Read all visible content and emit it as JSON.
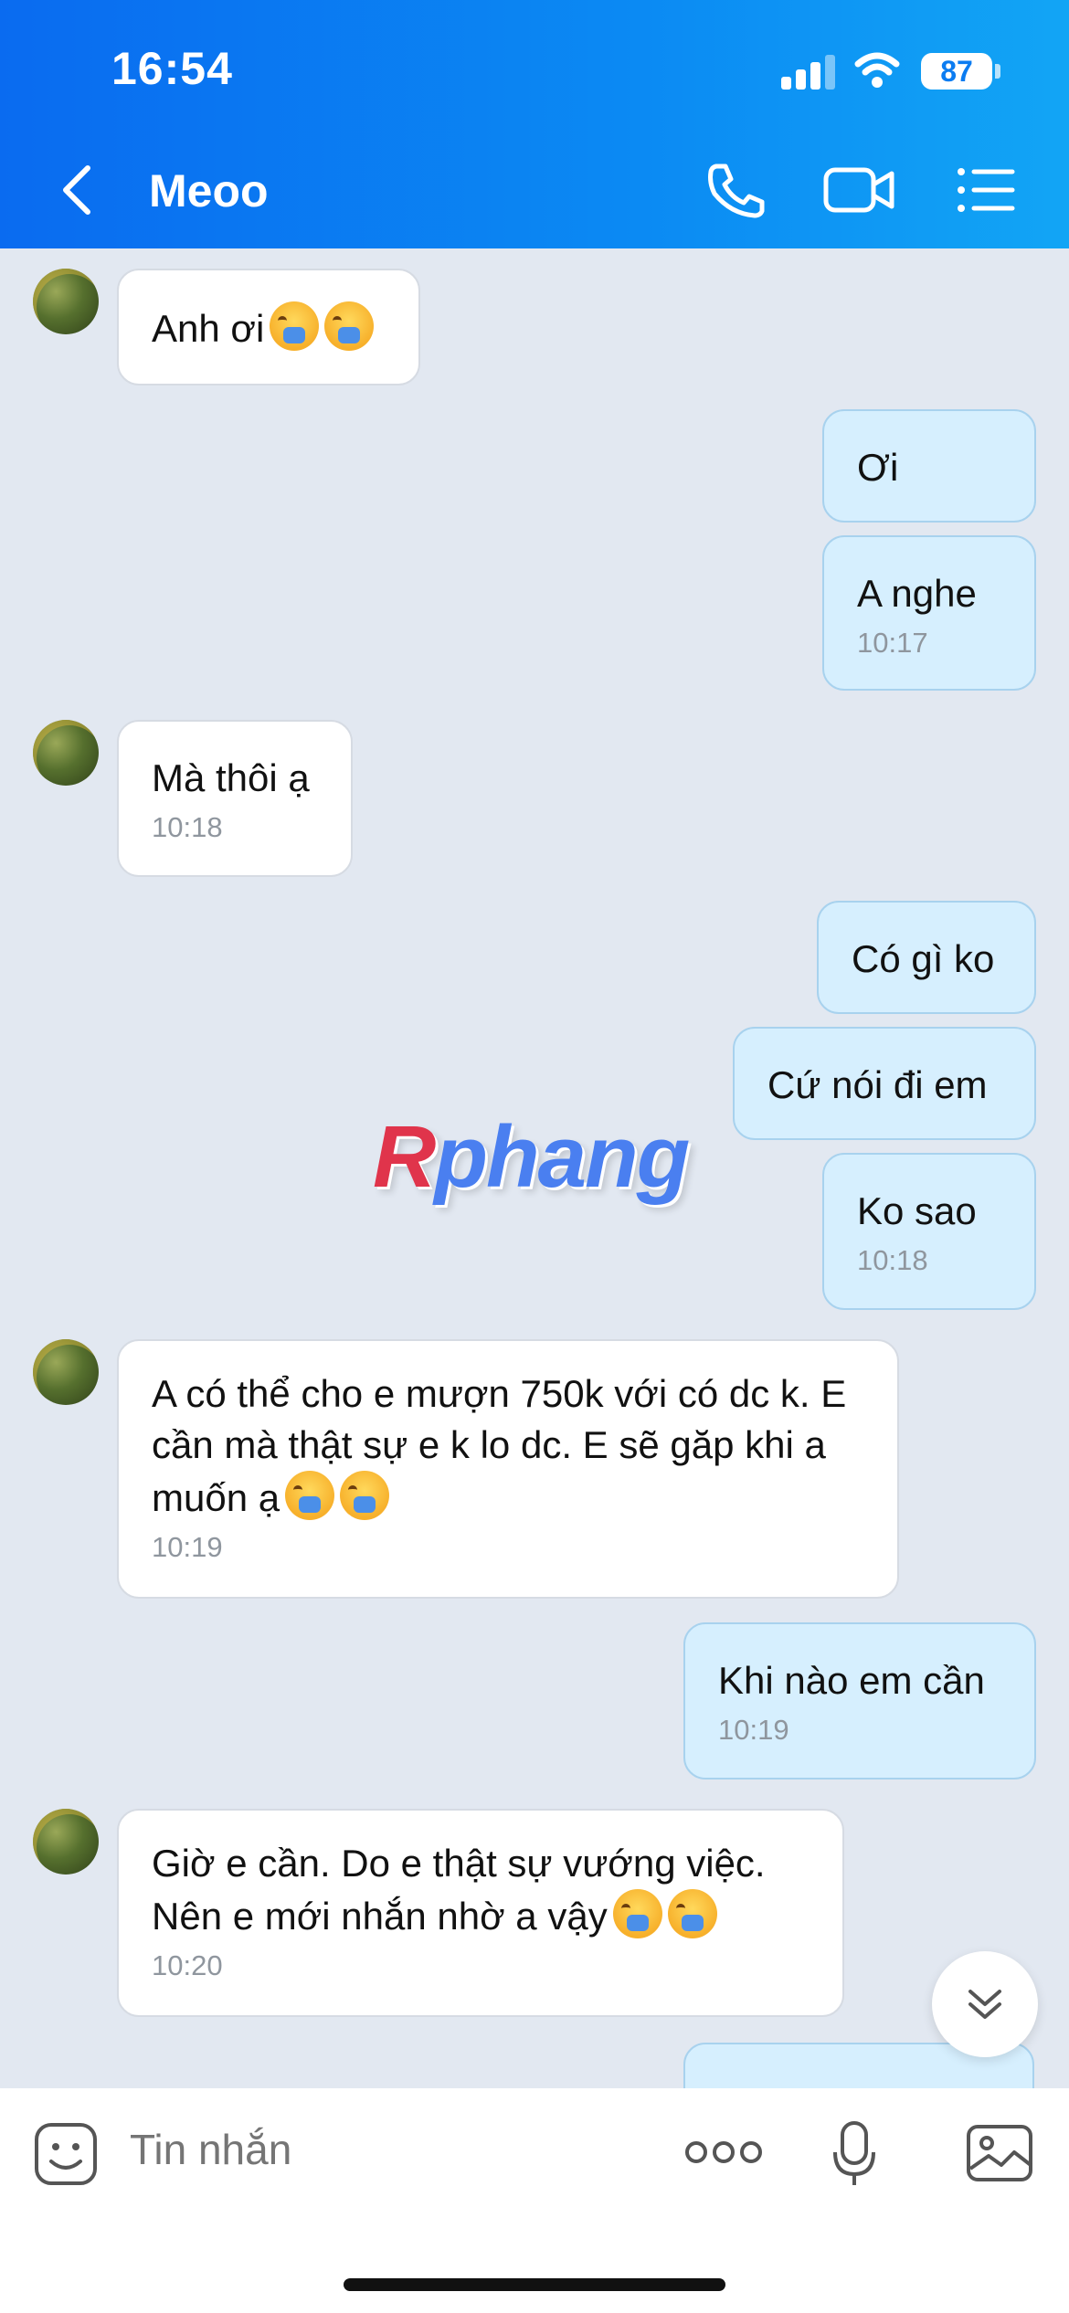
{
  "status_bar": {
    "time": "16:54",
    "battery": "87"
  },
  "header": {
    "title": "Meoo"
  },
  "messages": [
    {
      "text": "Anh ơi",
      "time": ""
    },
    {
      "text": "Ơi",
      "time": ""
    },
    {
      "text": "A nghe",
      "time": "10:17"
    },
    {
      "text": "Mà thôi ạ",
      "time": "10:18"
    },
    {
      "text": "Có gì ko",
      "time": ""
    },
    {
      "text": "Cứ nói đi em",
      "time": ""
    },
    {
      "text": "Ko sao",
      "time": "10:18"
    },
    {
      "text": "A có thể cho e mượn 750k với có dc k. E cần mà thật sự e k lo dc. E sẽ găp khi a muốn ạ",
      "time": "10:19"
    },
    {
      "text": "Khi nào em cần",
      "time": "10:19"
    },
    {
      "text": "Giờ e cần. Do e thật sự vướng việc. Nên e mới nhắn nhờ a vậy",
      "time": "10:20"
    }
  ],
  "watermark": {
    "first": "R",
    "rest": "phang"
  },
  "composer": {
    "placeholder": "Tin nhắn"
  },
  "colors": {
    "header_blue": "#0a6bf0",
    "outgoing_bubble": "#d6effe",
    "background": "#e2e8f1"
  }
}
